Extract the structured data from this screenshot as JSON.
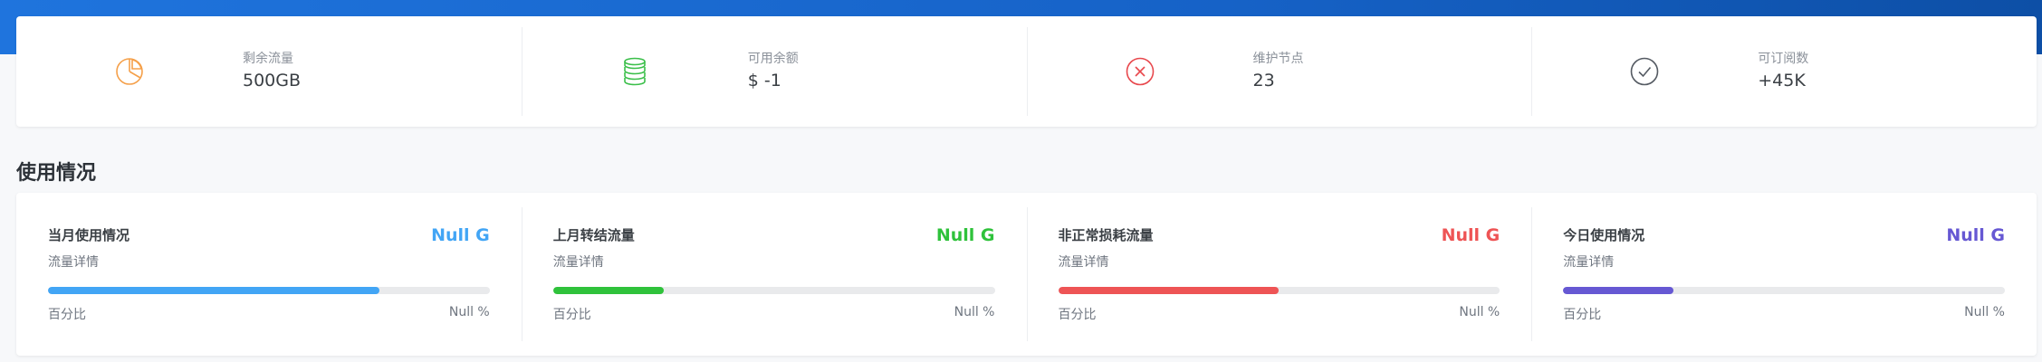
{
  "stats": [
    {
      "label": "剩余流量",
      "value": "500GB",
      "icon": "pie-chart-icon",
      "color": "#f5a04a"
    },
    {
      "label": "可用余额",
      "value": "$ -1",
      "icon": "coins-icon",
      "color": "#3bbf4a"
    },
    {
      "label": "维护节点",
      "value": "23",
      "icon": "close-circle-icon",
      "color": "#e8484d"
    },
    {
      "label": "可订阅数",
      "value": "+45K",
      "icon": "check-circle-icon",
      "color": "#555b63"
    }
  ],
  "section_title": "使用情况",
  "usage": [
    {
      "title": "当月使用情况",
      "amount": "Null G",
      "sub": "流量详情",
      "percent_label": "百分比",
      "percent_value": "Null %",
      "color": "#42a5f5",
      "fill": 0.75
    },
    {
      "title": "上月转结流量",
      "amount": "Null G",
      "sub": "流量详情",
      "percent_label": "百分比",
      "percent_value": "Null %",
      "color": "#2fc23b",
      "fill": 0.25
    },
    {
      "title": "非正常损耗流量",
      "amount": "Null G",
      "sub": "流量详情",
      "percent_label": "百分比",
      "percent_value": "Null %",
      "color": "#ee5455",
      "fill": 0.5
    },
    {
      "title": "今日使用情况",
      "amount": "Null G",
      "sub": "流量详情",
      "percent_label": "百分比",
      "percent_value": "Null %",
      "color": "#6658d3",
      "fill": 0.25
    }
  ]
}
